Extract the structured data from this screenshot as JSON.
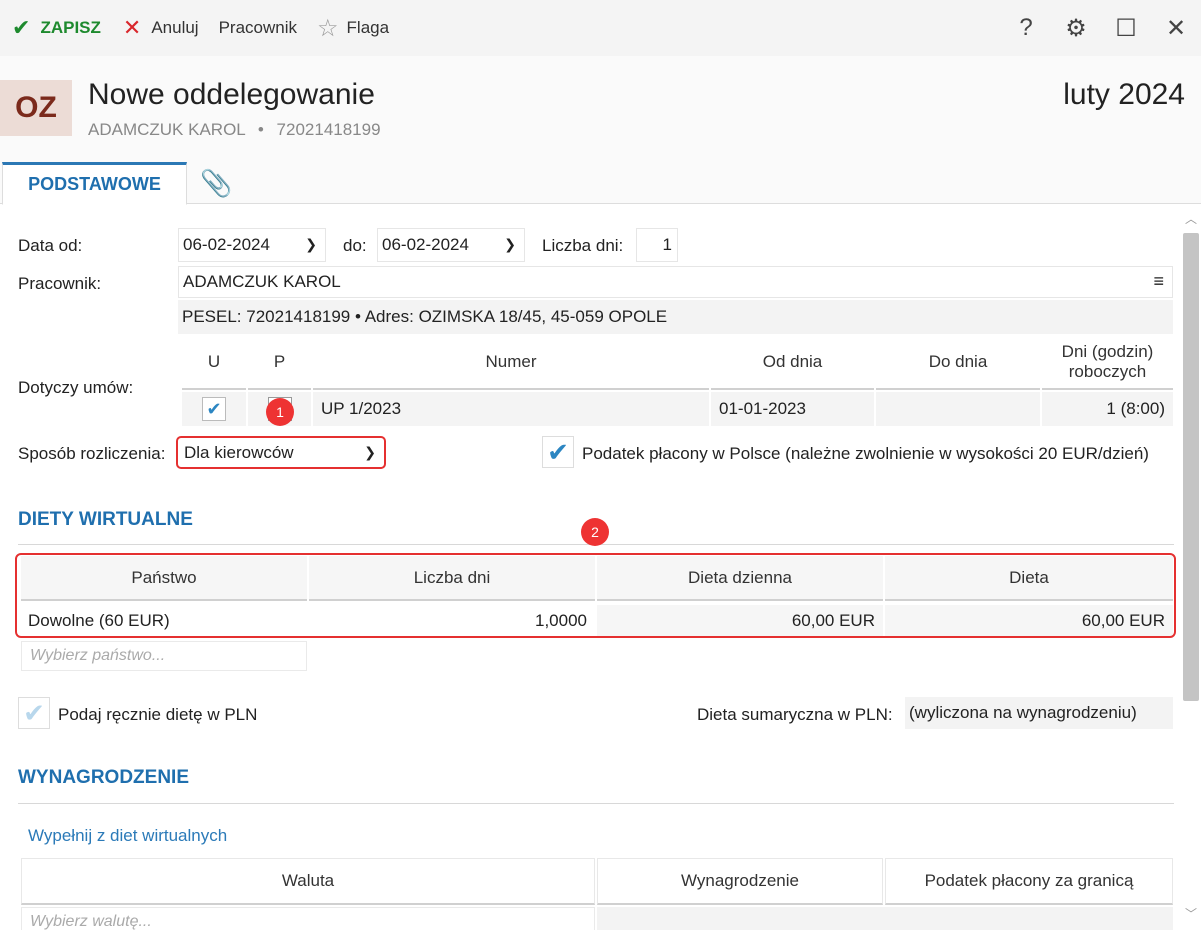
{
  "toolbar": {
    "save_label": "ZAPISZ",
    "cancel_label": "Anuluj",
    "employee_label": "Pracownik",
    "flag_label": "Flaga",
    "help_label": "?"
  },
  "header": {
    "avatar": "OZ",
    "title": "Nowe oddelegowanie",
    "employee_name": "ADAMCZUK KAROL",
    "separator": "•",
    "employee_pesel": "72021418199",
    "period": "luty 2024"
  },
  "tabs": {
    "main": "PODSTAWOWE"
  },
  "form": {
    "date_from_label": "Data od:",
    "date_from": "06-02-2024",
    "date_to_label": "do:",
    "date_to": "06-02-2024",
    "days_label": "Liczba dni:",
    "days": "1",
    "employee_label": "Pracownik:",
    "employee_value": "ADAMCZUK KAROL",
    "menu_glyph": "≡",
    "pesel_line": "PESEL:  72021418199  •  Adres:  OZIMSKA 18/45, 45-059 OPOLE",
    "contracts_label": "Dotyczy umów:",
    "contracts_headers": [
      "U",
      "P",
      "Numer",
      "Od dnia",
      "Do dnia",
      "Dni (godzin) roboczych"
    ],
    "contract_row": {
      "numer": "UP 1/2023",
      "od": "01-01-2023",
      "do": "",
      "dni": "1  (8:00)"
    },
    "settlement_label": "Sposób rozliczenia:",
    "settlement_value": "Dla kierowców",
    "tax_poland_label": "Podatek płacony w Polsce (należne zwolnienie w wysokości 20 EUR/dzień)"
  },
  "badges": {
    "one": "1",
    "two": "2"
  },
  "diets": {
    "section_title": "DIETY WIRTUALNE",
    "headers": [
      "Państwo",
      "Liczba dni",
      "Dieta dzienna",
      "Dieta"
    ],
    "row": {
      "country": "Dowolne (60 EUR)",
      "days": "1,0000",
      "daily": "60,00 EUR",
      "total": "60,00 EUR"
    },
    "country_placeholder": "Wybierz państwo...",
    "manual_label": "Podaj ręcznie dietę w PLN",
    "summary_label": "Dieta sumaryczna w PLN:",
    "summary_value": "(wyliczona na wynagrodzeniu)"
  },
  "salary": {
    "section_title": "WYNAGRODZENIE",
    "fill_link": "Wypełnij z diet wirtualnych",
    "headers": [
      "Waluta",
      "Wynagrodzenie",
      "Podatek płacony za granicą"
    ],
    "currency_placeholder": "Wybierz walutę..."
  }
}
